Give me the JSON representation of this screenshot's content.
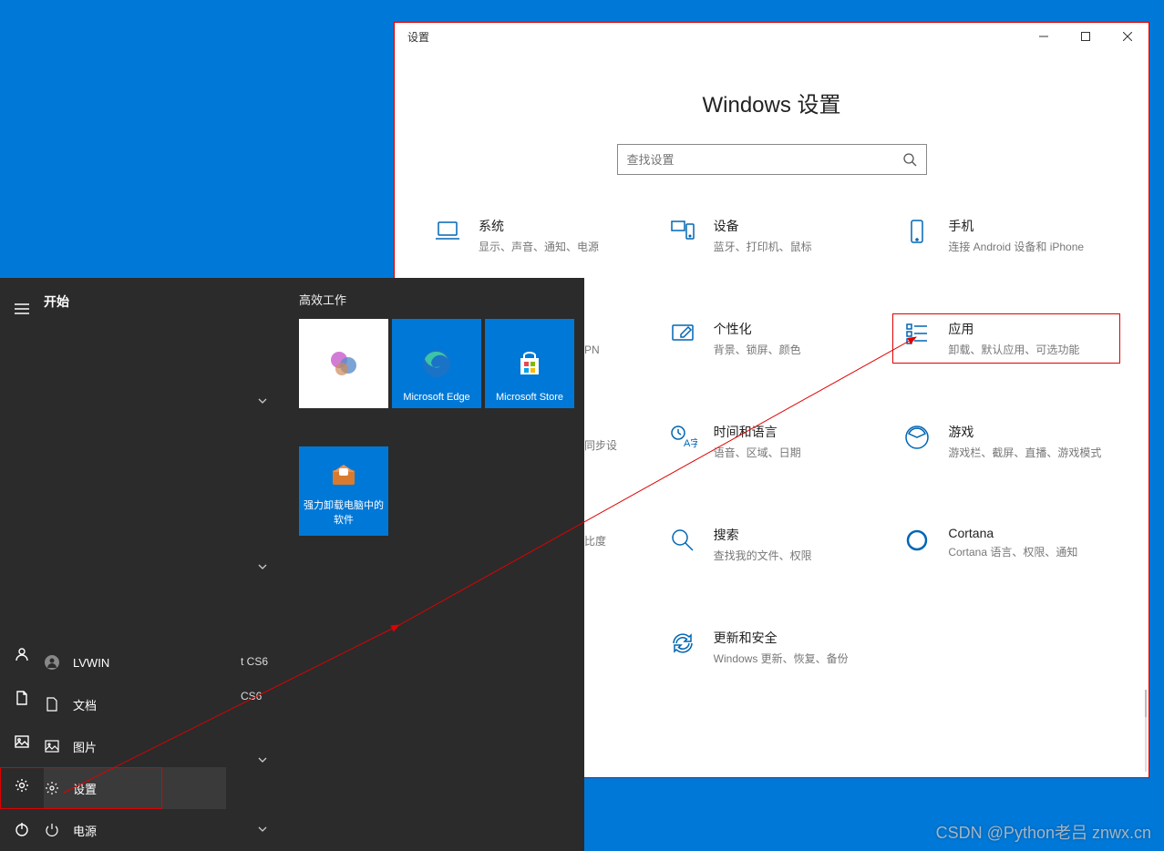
{
  "settings_window": {
    "title": "设置",
    "heading": "Windows 设置",
    "search_placeholder": "查找设置",
    "categories": [
      {
        "title": "系统",
        "desc": "显示、声音、通知、电源",
        "icon": "laptop"
      },
      {
        "title": "设备",
        "desc": "蓝牙、打印机、鼠标",
        "icon": "devices"
      },
      {
        "title": "手机",
        "desc": "连接 Android 设备和 iPhone",
        "icon": "phone"
      },
      {
        "title": "个性化",
        "desc": "背景、锁屏、颜色",
        "icon": "personalize"
      },
      {
        "title": "应用",
        "desc": "卸载、默认应用、可选功能",
        "icon": "apps",
        "highlight": true
      },
      {
        "title": "时间和语言",
        "desc": "语音、区域、日期",
        "icon": "time-lang"
      },
      {
        "title": "游戏",
        "desc": "游戏栏、截屏、直播、游戏模式",
        "icon": "gaming"
      },
      {
        "title": "搜索",
        "desc": "查找我的文件、权限",
        "icon": "search"
      },
      {
        "title": "Cortana",
        "desc": "Cortana 语言、权限、通知",
        "icon": "cortana"
      },
      {
        "title": "更新和安全",
        "desc": "Windows 更新、恢复、备份",
        "icon": "update"
      }
    ],
    "partial_texts": {
      "vpn": "PN",
      "sync": "同步设",
      "contrast": "比度"
    }
  },
  "start_menu": {
    "title": "开始",
    "group_title": "高效工作",
    "tiles": {
      "office": "",
      "edge": "Microsoft Edge",
      "store": "Microsoft Store",
      "uninstaller": "强力卸载电脑中的软件"
    },
    "mid_texts": {
      "t1": "t CS6",
      "t2": "CS6"
    },
    "bottom_items": [
      {
        "label": "LVWIN",
        "icon": "user"
      },
      {
        "label": "文档",
        "icon": "doc"
      },
      {
        "label": "图片",
        "icon": "pic"
      },
      {
        "label": "设置",
        "icon": "gear",
        "highlight": true
      },
      {
        "label": "电源",
        "icon": "power"
      }
    ]
  },
  "watermark": "CSDN @Python老吕  znwx.cn"
}
